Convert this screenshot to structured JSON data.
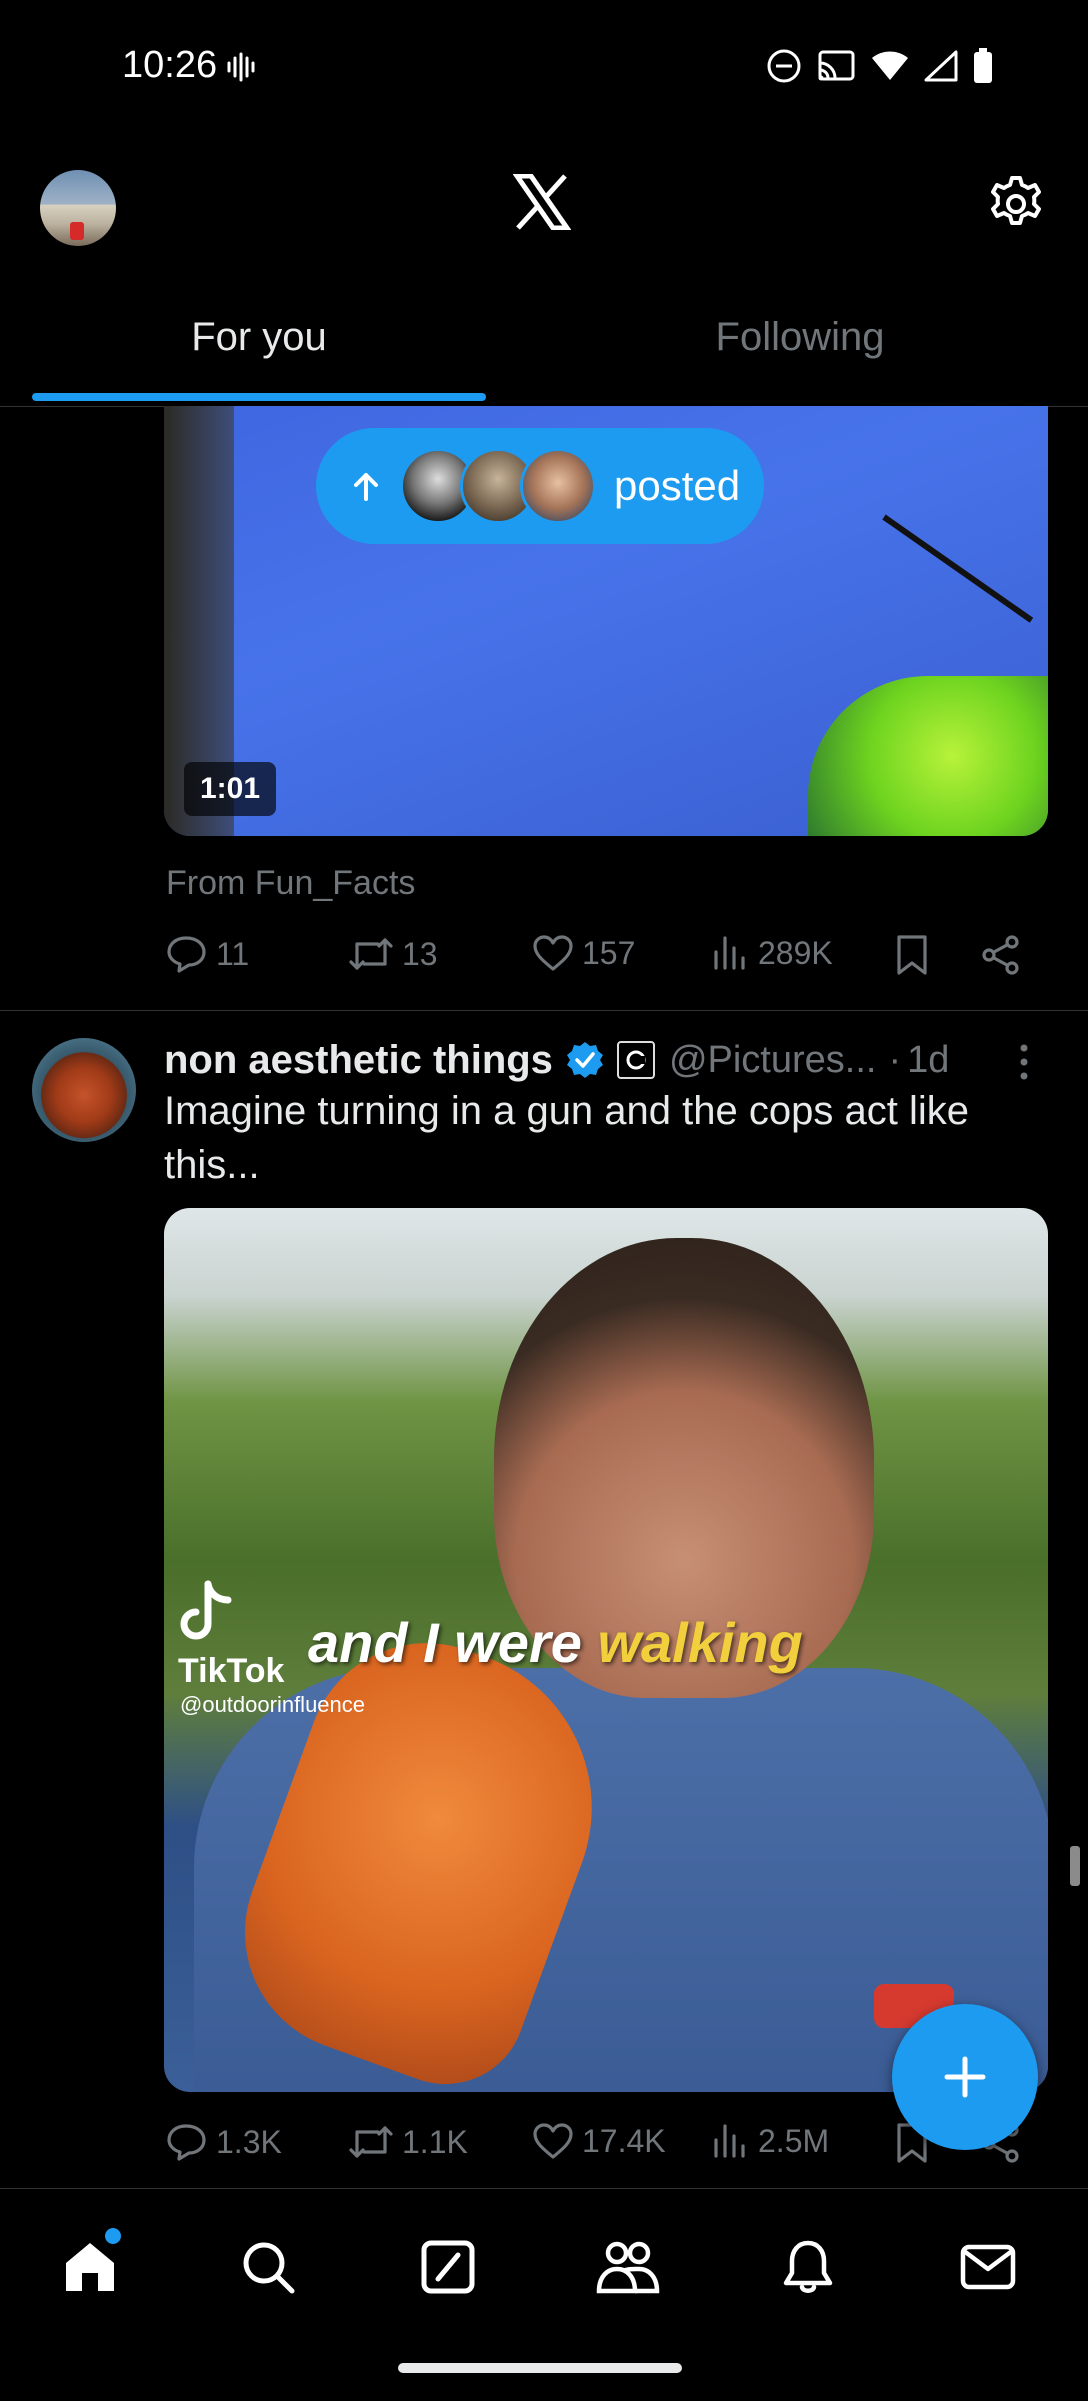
{
  "status_bar": {
    "time": "10:26"
  },
  "header": {
    "logo": "x-logo",
    "settings_icon": "gear-icon",
    "profile_avatar": "avatar"
  },
  "tabs": [
    {
      "label": "For you",
      "active": true
    },
    {
      "label": "Following",
      "active": false
    }
  ],
  "new_posts_pill": {
    "label": "posted"
  },
  "tweet1": {
    "video_duration": "1:01",
    "source": "From Fun_Facts",
    "stats": {
      "replies": "11",
      "reposts": "13",
      "likes": "157",
      "views": "289K"
    }
  },
  "tweet2": {
    "author_name": "non aesthetic things",
    "handle": "@Pictures...",
    "separator": "·",
    "age": "1d",
    "text": "Imagine turning in a gun and the cops act like this...",
    "video_overlay": {
      "tiktok_label": "TikTok",
      "tiktok_user": "@outdoorinfluence",
      "caption_white": "and I were",
      "caption_yellow": "walking"
    },
    "stats": {
      "replies": "1.3K",
      "reposts": "1.1K",
      "likes": "17.4K",
      "views": "2.5M"
    }
  },
  "bottom_nav": [
    "home-icon",
    "search-icon",
    "grok-icon",
    "communities-icon",
    "notifications-icon",
    "messages-icon"
  ],
  "colors": {
    "accent": "#1d9bf0",
    "background": "#000000",
    "muted": "#71767b",
    "text": "#e7e9ea"
  }
}
